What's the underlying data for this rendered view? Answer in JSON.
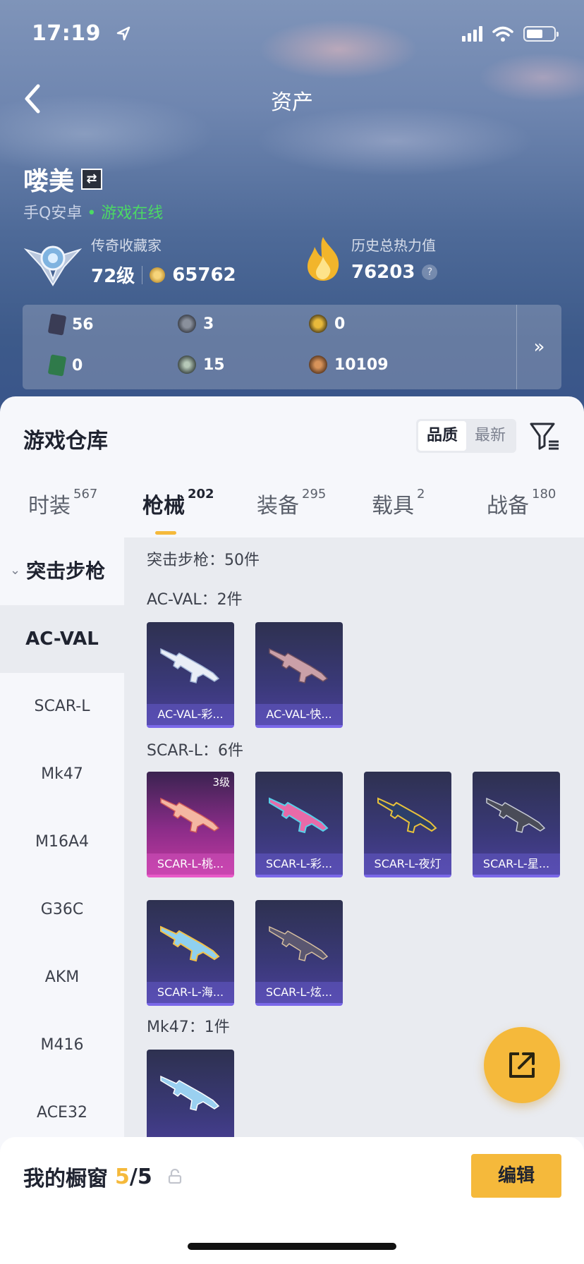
{
  "status": {
    "time": "17:19"
  },
  "nav": {
    "title": "资产"
  },
  "profile": {
    "name": "喽美",
    "platform": "手Q安卓",
    "online": "• 游戏在线",
    "rank_label": "传奇收藏家",
    "level": "72级",
    "coins": "65762",
    "heat_label": "历史总热力值",
    "heat_value": "76203",
    "heat_help": "?"
  },
  "stats": [
    "56",
    "3",
    "0",
    "0",
    "15",
    "10109"
  ],
  "stats_more": "»",
  "warehouse": {
    "title": "游戏仓库",
    "sort": [
      "品质",
      "最新"
    ],
    "tabs": [
      {
        "label": "时装",
        "count": "567"
      },
      {
        "label": "枪械",
        "count": "202"
      },
      {
        "label": "装备",
        "count": "295"
      },
      {
        "label": "载具",
        "count": "2"
      },
      {
        "label": "战备",
        "count": "180"
      }
    ]
  },
  "sidebar": {
    "category": "突击步枪",
    "items": [
      "AC-VAL",
      "SCAR-L",
      "Mk47",
      "M16A4",
      "G36C",
      "AKM",
      "M416",
      "ACE32"
    ]
  },
  "content": {
    "summary": "突击步枪：50件",
    "groups": [
      {
        "label": "AC-VAL：2件",
        "items": [
          "AC-VAL-彩...",
          "AC-VAL-快..."
        ]
      },
      {
        "label": "SCAR-L：6件",
        "items": [
          "SCAR-L-桃...",
          "SCAR-L-彩...",
          "SCAR-L-夜灯",
          "SCAR-L-星...",
          "SCAR-L-海...",
          "SCAR-L-炫..."
        ]
      },
      {
        "label": "Mk47：1件",
        "items": [
          ""
        ]
      }
    ],
    "level_badge": "3级"
  },
  "bottom": {
    "showcase_label": "我的橱窗",
    "showcase_used": "5",
    "showcase_total": "/5",
    "edit": "编辑"
  },
  "colors": {
    "accent": "#f5b93b",
    "online": "#4cd964",
    "card": "#3a3978",
    "card_highlight": "#c03aa0"
  }
}
